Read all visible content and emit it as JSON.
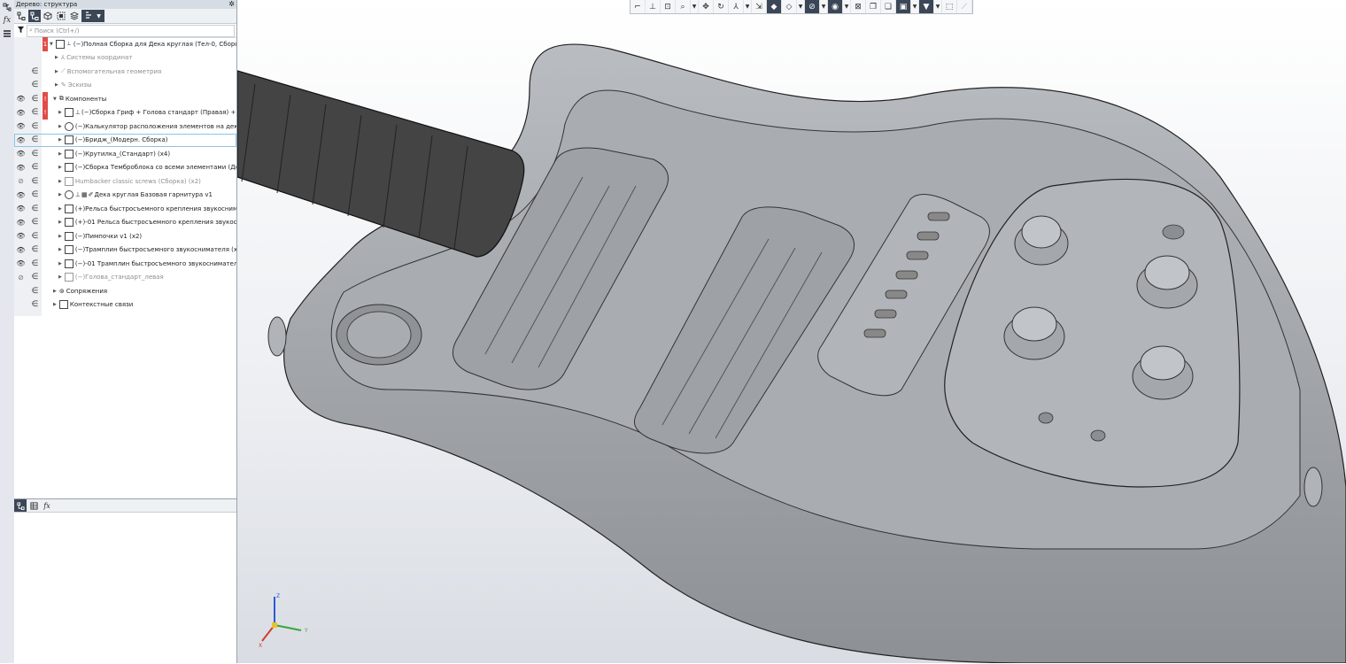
{
  "panel": {
    "title": "Дерево: структура",
    "search_placeholder": "Поиск (Ctrl+/)"
  },
  "left_strip": {
    "fx_label": "fx"
  },
  "tree": {
    "rows": [
      {
        "label": "(−)Полная Сборка для Дека круглая (Тел-0, Сборочных",
        "warn": "1"
      },
      {
        "label": "Системы координат"
      },
      {
        "label": "Вспомогательная геометрия"
      },
      {
        "label": "Эскизы"
      },
      {
        "label": "Компоненты",
        "warn": "!"
      },
      {
        "label": "(−)Сборка Гриф + Голова стандарт (Правая) + Накла",
        "warn": "!"
      },
      {
        "label": "(−)Калькулятор расположения элементов на деке в зав"
      },
      {
        "label": "(−)Бридж_(Модерн. Сборка)"
      },
      {
        "label": "(−)Крутилка_(Стандарт) (x4)"
      },
      {
        "label": "(−)Сборка Темброблока со всеми элементами (Дека кру"
      },
      {
        "label": "Humbacker classic screws (Сборка) (x2)"
      },
      {
        "label": "Дека круглая Базовая гарнитура v1"
      },
      {
        "label": "(+)Рельса быстросъемного крепления звукоснимателя"
      },
      {
        "label": "(+)-01 Рельса быстросъемного крепления звукоснимател"
      },
      {
        "label": "(−)Пимпочки v1 (x2)"
      },
      {
        "label": "(−)Трамплин быстросъемного звукоснимателя (x2)"
      },
      {
        "label": "(−)-01 Трамплин быстросъемного звукоснимателя (x2)"
      },
      {
        "label": "(−)Голова_стандарт_левая"
      },
      {
        "label": "Сопряжения"
      },
      {
        "label": "Контекстные связи"
      }
    ]
  },
  "bottom_tabs": {
    "fx": "fx"
  },
  "viewport": {
    "axis_z": "Z",
    "axis_x": "X",
    "axis_y": "Y"
  }
}
